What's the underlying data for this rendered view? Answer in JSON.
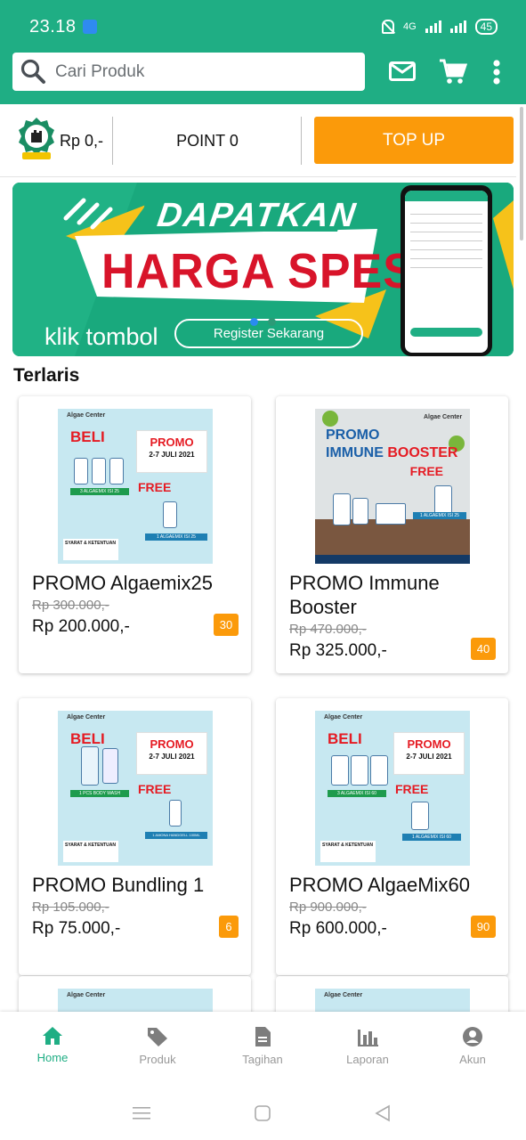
{
  "status_bar": {
    "time": "23.18",
    "network": "4G",
    "battery": "45"
  },
  "header": {
    "search_placeholder": "Cari Produk",
    "icons": [
      "mail-icon",
      "cart-icon",
      "more-vert-icon"
    ],
    "accent_color": "#1fae84"
  },
  "balance": {
    "amount": "Rp 0,-",
    "point": "POINT 0",
    "topup_label": "TOP UP",
    "topup_color": "#fb9a0a"
  },
  "banner": {
    "title_line1": "DAPATKAN",
    "title_line2": "HARGA SPESIAL",
    "subtitle": "klik tombol",
    "button_label": "Register Sekarang",
    "active_slide": 1,
    "slide_count": 2
  },
  "section_title": "Terlaris",
  "products": [
    {
      "name": "PROMO Algaemix25",
      "old_price": "Rp 300.000,-",
      "price": "Rp 200.000,-",
      "badge": "30",
      "thumb": {
        "brand": "Algae Center",
        "beli": "BELI",
        "promo": "PROMO",
        "date": "2-7 JULI 2021",
        "free": "FREE",
        "label_buy": "3 ALGAEMIX ISI 25",
        "label_free": "1 ALGAEMIX ISI 25",
        "terms": "SYARAT & KETENTUAN"
      }
    },
    {
      "name": "PROMO Immune Booster",
      "old_price": "Rp 470.000,-",
      "price": "Rp 325.000,-",
      "badge": "40",
      "thumb": {
        "brand": "Algae Center",
        "title_line1": "PROMO",
        "title_line2a": "IMMUNE ",
        "title_line2b": "BOOSTER",
        "free": "FREE",
        "label_buy": "1 ALGAEMIX ISI 25"
      }
    },
    {
      "name": "PROMO Bundling 1",
      "old_price": "Rp 105.000,-",
      "price": "Rp 75.000,-",
      "badge": "6",
      "thumb": {
        "brand": "Algae Center",
        "beli": "BELI",
        "promo": "PROMO",
        "date": "2-7 JULI 2021",
        "free": "FREE",
        "label_buy": "1 PCS BODY WASH",
        "label_free": "1 AMONA HANDGELL 100ML",
        "terms": "SYARAT & KETENTUAN"
      }
    },
    {
      "name": "PROMO AlgaeMix60",
      "old_price": "Rp 900.000,-",
      "price": "Rp 600.000,-",
      "badge": "90",
      "thumb": {
        "brand": "Algae Center",
        "beli": "BELI",
        "promo": "PROMO",
        "date": "2-7 JULI 2021",
        "free": "FREE",
        "label_buy": "3 ALGAEMIX ISI 60",
        "label_free": "1 ALGAEMIX ISI 60",
        "terms": "SYARAT & KETENTUAN"
      }
    }
  ],
  "partial_cards": {
    "brand": "Algae Center"
  },
  "bottom_nav": [
    {
      "label": "Home",
      "icon": "home-icon",
      "active": true
    },
    {
      "label": "Produk",
      "icon": "tag-icon",
      "active": false
    },
    {
      "label": "Tagihan",
      "icon": "document-icon",
      "active": false
    },
    {
      "label": "Laporan",
      "icon": "bar-chart-icon",
      "active": false
    },
    {
      "label": "Akun",
      "icon": "account-icon",
      "active": false
    }
  ]
}
